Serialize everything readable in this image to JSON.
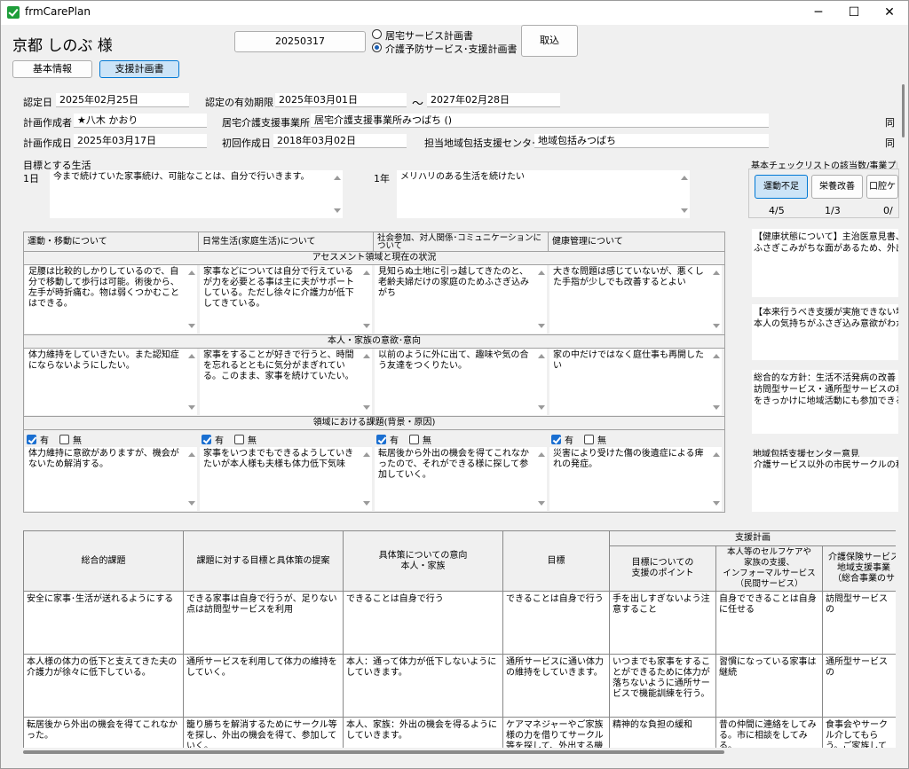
{
  "window": {
    "title": "frmCarePlan",
    "minimize": "─",
    "maximize": "☐",
    "close": "✕"
  },
  "header": {
    "patient_name": "京都 しのぶ 様",
    "plan_date": "20250317",
    "radio_home": "居宅サービス計画書",
    "radio_prevent": "介護予防サービス･支援計画書",
    "import_button": "取込"
  },
  "tabs": {
    "basic": "基本情報",
    "support": "支援計画書"
  },
  "fields": {
    "cert_date_label": "認定日",
    "cert_date": "2025年02月25日",
    "valid_label": "認定の有効期限",
    "valid_from": "2025年03月01日",
    "tilde": "～",
    "valid_to": "2027年02月28日",
    "creator_label": "計画作成者",
    "creator": "★八木 かおり",
    "office_label": "居宅介護支援事業所",
    "office": "居宅介護支援事業所みつばち ()",
    "created_label": "計画作成日",
    "created": "2025年03月17日",
    "first_label": "初回作成日",
    "first": "2018年03月02日",
    "center_label": "担当地域包括支援センター",
    "center": "地域包括みつばち",
    "same1": "同",
    "same2": "同"
  },
  "goals": {
    "label": "目標とする生活",
    "day_label": "1日",
    "day_text": "今まで続けていた家事続け、可能なことは、自分で行いきます。",
    "year_label": "1年",
    "year_text": "メリハリのある生活を続けたい"
  },
  "assessment": {
    "columns": [
      "運動・移動について",
      "日常生活(家庭生活)について",
      "社会参加、対人関係･コミュニケーションについて",
      "健康管理について"
    ],
    "section1": "アセスメント領域と現在の状況",
    "status": [
      "足腰は比較的しかりしているので、自分で移動して歩行は可能。術後から、左手が時折痛む。物は弱くつかむことはできる。",
      "家事などについては自分で行えているが力を必要とる事は主に夫がサポートしている。ただし徐々に介護力が低下してきている。",
      "見知らぬ土地に引っ越してきたのと、老齢夫婦だけの家庭のためふさぎ込みがち",
      "大きな問題は感じていないが、悪くした手指が少しでも改善するとよい"
    ],
    "section2": "本人・家族の意欲･意向",
    "wishes": [
      "体力維持をしていきたい。また認知症にならないようにしたい。",
      "家事をすることが好きで行うと、時間を忘れるとともに気分がまぎれている。このまま、家事を続けていたい。",
      "以前のように外に出て、趣味や気の合う友達をつくりたい。",
      "家の中だけではなく庭仕事も再開したい"
    ],
    "section3": "領域における課題(背景・原因)",
    "yes": "有",
    "no": "無",
    "issues": [
      "体力維持に意欲がありますが、機会がないため解消する。",
      "家事をいつまでもできるようしていきたいが本人様も夫様も体力低下気味",
      "転居後から外出の機会を得てこれなかったので、それができる様に探して参加していく。",
      "災害により受けた傷の後遺症による痺れの発症。"
    ]
  },
  "right_panel": {
    "checklist_label": "基本チェックリストの該当数/事業プログ",
    "chk_buttons": [
      "運動不足",
      "栄養改善",
      "口腔ケ"
    ],
    "chk_counts": [
      "4/5",
      "1/3",
      "0/"
    ],
    "health_title": "【健康状態について】主治医意見書、",
    "health_text": "ふさぎこみがちな面があるため、外出の",
    "support_title": "【本来行うべき支援が実施できない場",
    "support_text": "本人の気持ちがふさぎ込み意欲がわか",
    "policy_title": "総合的な方針：生活不活発病の改善",
    "policy_text1": "訪問型サービス・通所型サービスの利",
    "policy_text2": "をきっかけに地域活動にも参加できる",
    "opinion_label": "地域包括支援センター意見",
    "opinion_text": "介護サービス以外の市民サークルの利"
  },
  "plan_table": {
    "support_plan": "支援計画",
    "headers": [
      "総合的課題",
      "課題に対する目標と具体策の提案",
      "具体策についての意向\n本人・家族",
      "目標",
      "目標についての\n支援のポイント",
      "本人等のセルフケアや\n家族の支援、\nインフォーマルサービス\n（民間サービス）",
      "介護保険サービス\n地域支援事業\n（総合事業のサ"
    ],
    "rows": [
      [
        "安全に家事･生活が送れるようにする",
        "できる家事は自身で行うが、足りない点は訪問型サービスを利用",
        "できることは自身で行う",
        "できることは自身で行う",
        "手を出しすぎないよう注意すること",
        "自身でできることは自身に任せる",
        "訪問型サービスの"
      ],
      [
        "本人様の体力の低下と支えてきた夫の介護力が徐々に低下している。",
        "通所サービスを利用して体力の維持をしていく。",
        "本人：通って体力が低下しないようにしていきます。",
        "通所サービスに通い体力の維持をしていきます。",
        "いつまでも家事をすることができるために体力が落ちないように通所サービスで機能訓練を行う。",
        "習慣になっている家事は継続",
        "通所型サービスの"
      ],
      [
        "転居後から外出の機会を得てこれなかった。",
        "籠り勝ちを解消するためにサークル等を探し、外出の機会を得て、参加していく。",
        "本人、家族：外出の機会を得るようにしていきます。",
        "ケアマネジャーやご家族様の力を借りてサークル等を探して、外出する機会を",
        "精神的な負担の緩和",
        "昔の仲間に連絡をしてみる。市に相談をしてみる。",
        "食事会やサークル介してもらう。ご家族して探してもらう"
      ]
    ]
  }
}
